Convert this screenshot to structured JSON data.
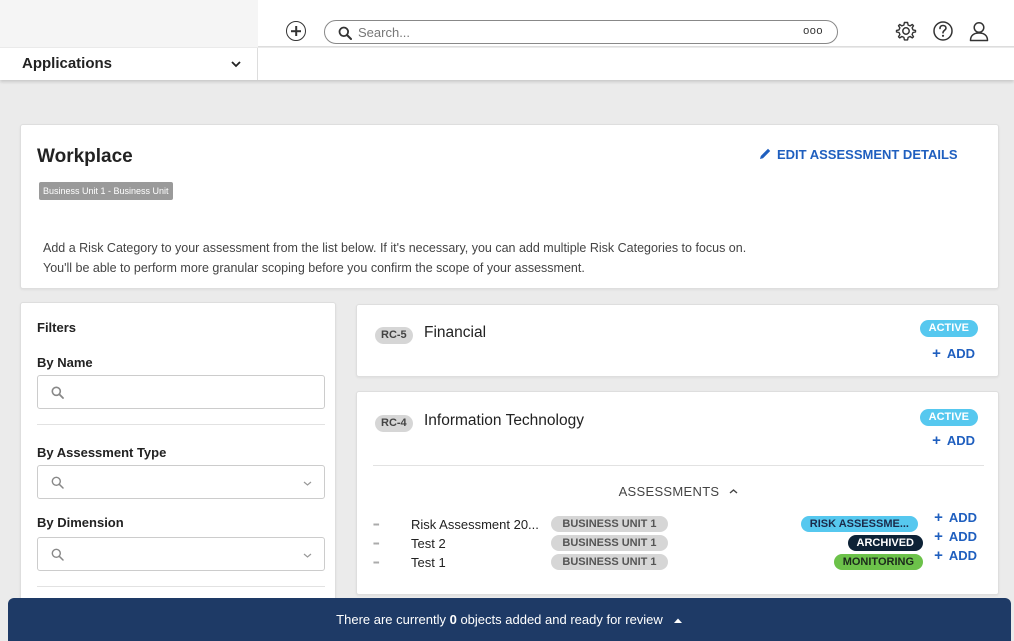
{
  "topbar": {
    "search_placeholder": "Search...",
    "search_more": "ooo",
    "icons": [
      "add-circle-icon",
      "search-icon",
      "gear-icon",
      "help-icon",
      "user-icon"
    ]
  },
  "appbar": {
    "label": "Applications"
  },
  "workplace": {
    "title": "Workplace",
    "badge": "Business Unit 1 - Business Unit",
    "edit_label": "EDIT ASSESSMENT DETAILS",
    "description_line1": "Add a Risk Category to your assessment from the list below. If it's necessary, you can add multiple Risk Categories to focus on.",
    "description_line2": "You'll be able to perform more granular scoping before you confirm the scope of your assessment."
  },
  "filters": {
    "title": "Filters",
    "by_name": "By Name",
    "by_assessment_type": "By Assessment Type",
    "by_dimension": "By Dimension"
  },
  "categories": [
    {
      "code": "RC-5",
      "name": "Financial",
      "status": "ACTIVE",
      "add_label": "ADD"
    },
    {
      "code": "RC-4",
      "name": "Information Technology",
      "status": "ACTIVE",
      "add_label": "ADD",
      "assessments_header": "ASSESSMENTS",
      "assessments": [
        {
          "name": "Risk Assessment 20...",
          "business_unit": "BUSINESS UNIT 1",
          "status": "RISK ASSESSME...",
          "status_color": "#56c8ef",
          "status_text_color": "#1b2a4a",
          "add_label": "ADD"
        },
        {
          "name": "Test 2",
          "business_unit": "BUSINESS UNIT 1",
          "status": "ARCHIVED",
          "status_color": "#0d2236",
          "status_text_color": "#ffffff",
          "add_label": "ADD"
        },
        {
          "name": "Test 1",
          "business_unit": "BUSINESS UNIT 1",
          "status": "MONITORING",
          "status_color": "#6cc24a",
          "status_text_color": "#1b2a1b",
          "add_label": "ADD"
        }
      ]
    }
  ],
  "footer": {
    "text_before": "There are currently ",
    "count": "0",
    "text_after": " objects added and ready for review"
  },
  "colors": {
    "accent": "#1f5fbf",
    "active_badge": "#56c8ef",
    "footer_bg": "#1e3a66"
  }
}
